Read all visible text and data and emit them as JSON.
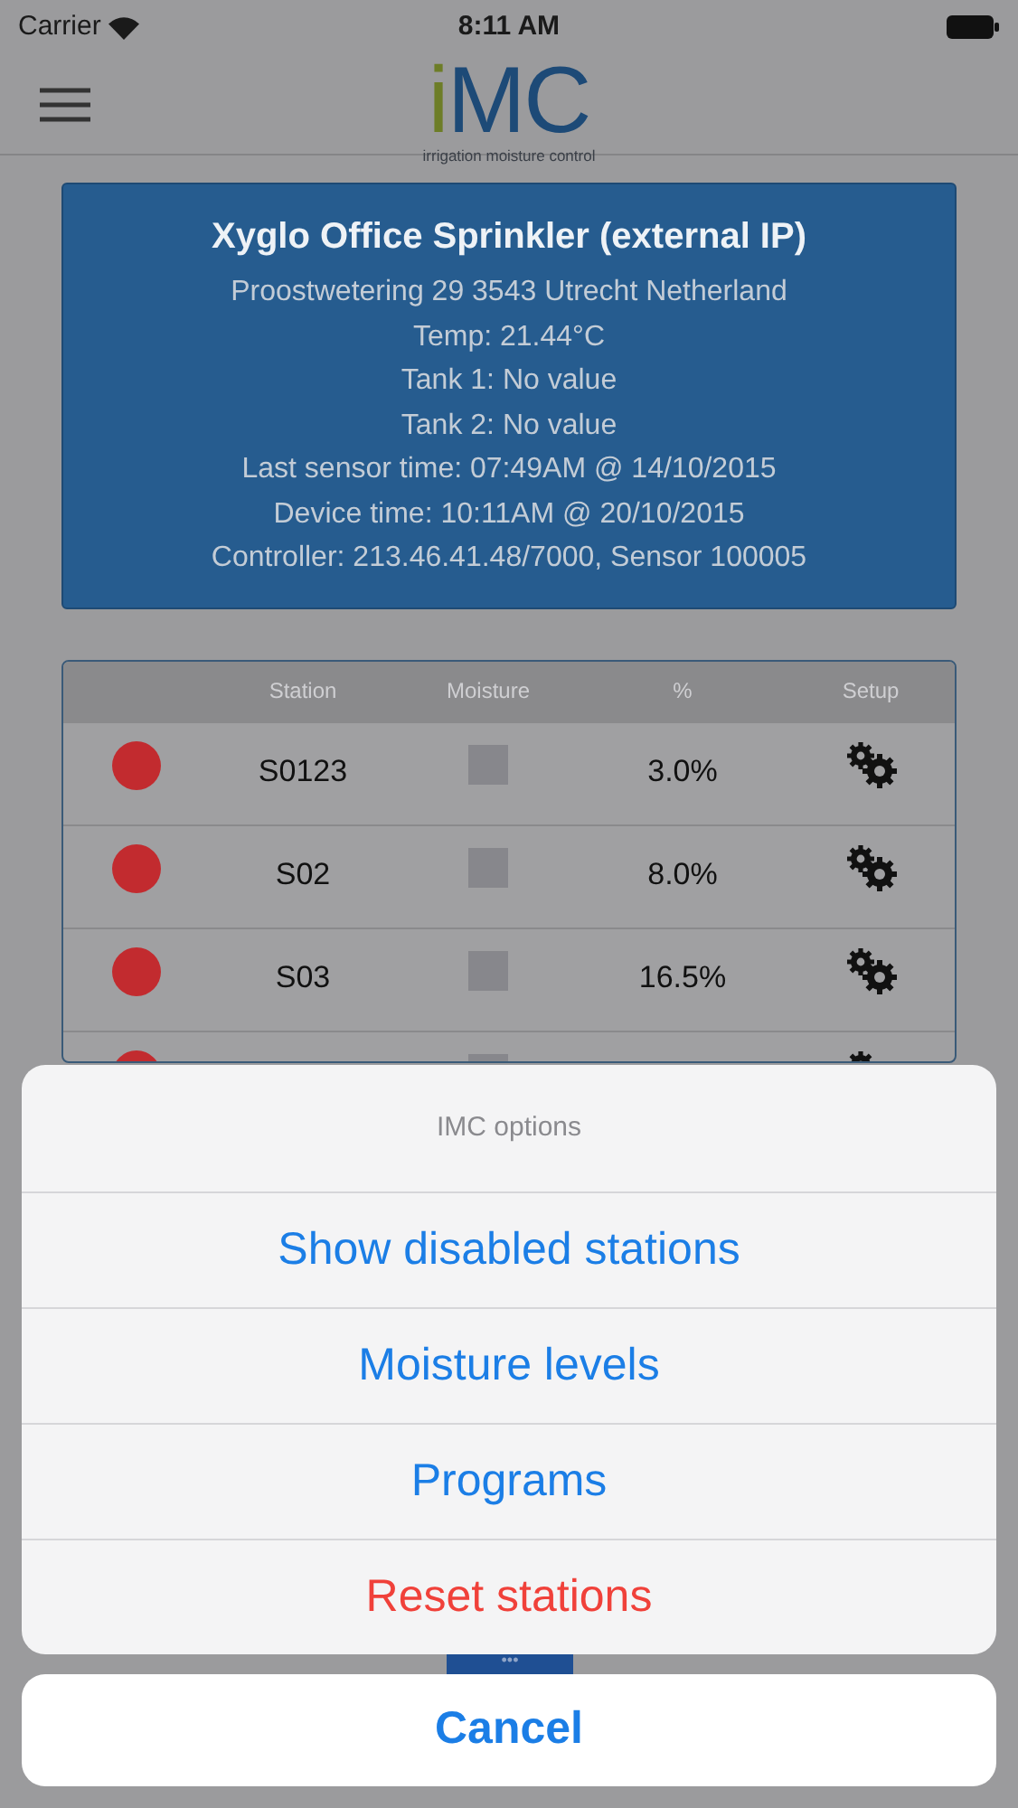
{
  "status_bar": {
    "carrier": "Carrier",
    "time": "8:11 AM"
  },
  "logo": {
    "accent": "i",
    "main": "MC",
    "tagline": "irrigation moisture control"
  },
  "device": {
    "title": "Xyglo Office Sprinkler (external IP)",
    "lines": [
      "Proostwetering 29 3543 Utrecht Netherland",
      "Temp: 21.44°C",
      "Tank 1: No value",
      "Tank 2: No value",
      "Last sensor time: 07:49AM @ 14/10/2015",
      "Device time: 10:11AM @ 20/10/2015",
      "Controller: 213.46.41.48/7000, Sensor 100005"
    ]
  },
  "table": {
    "columns": [
      "Station",
      "Moisture",
      "%",
      "Setup"
    ],
    "rows": [
      {
        "station": "S0123",
        "percent": "3.0%"
      },
      {
        "station": "S02",
        "percent": "8.0%"
      },
      {
        "station": "S03",
        "percent": "16.5%"
      },
      {}
    ]
  },
  "more_tab": "•••",
  "action_sheet": {
    "title": "IMC options",
    "items": [
      {
        "label": "Show disabled stations",
        "kind": "default"
      },
      {
        "label": "Moisture levels",
        "kind": "default"
      },
      {
        "label": "Programs",
        "kind": "default"
      },
      {
        "label": "Reset stations",
        "kind": "destructive"
      }
    ],
    "cancel": "Cancel"
  }
}
